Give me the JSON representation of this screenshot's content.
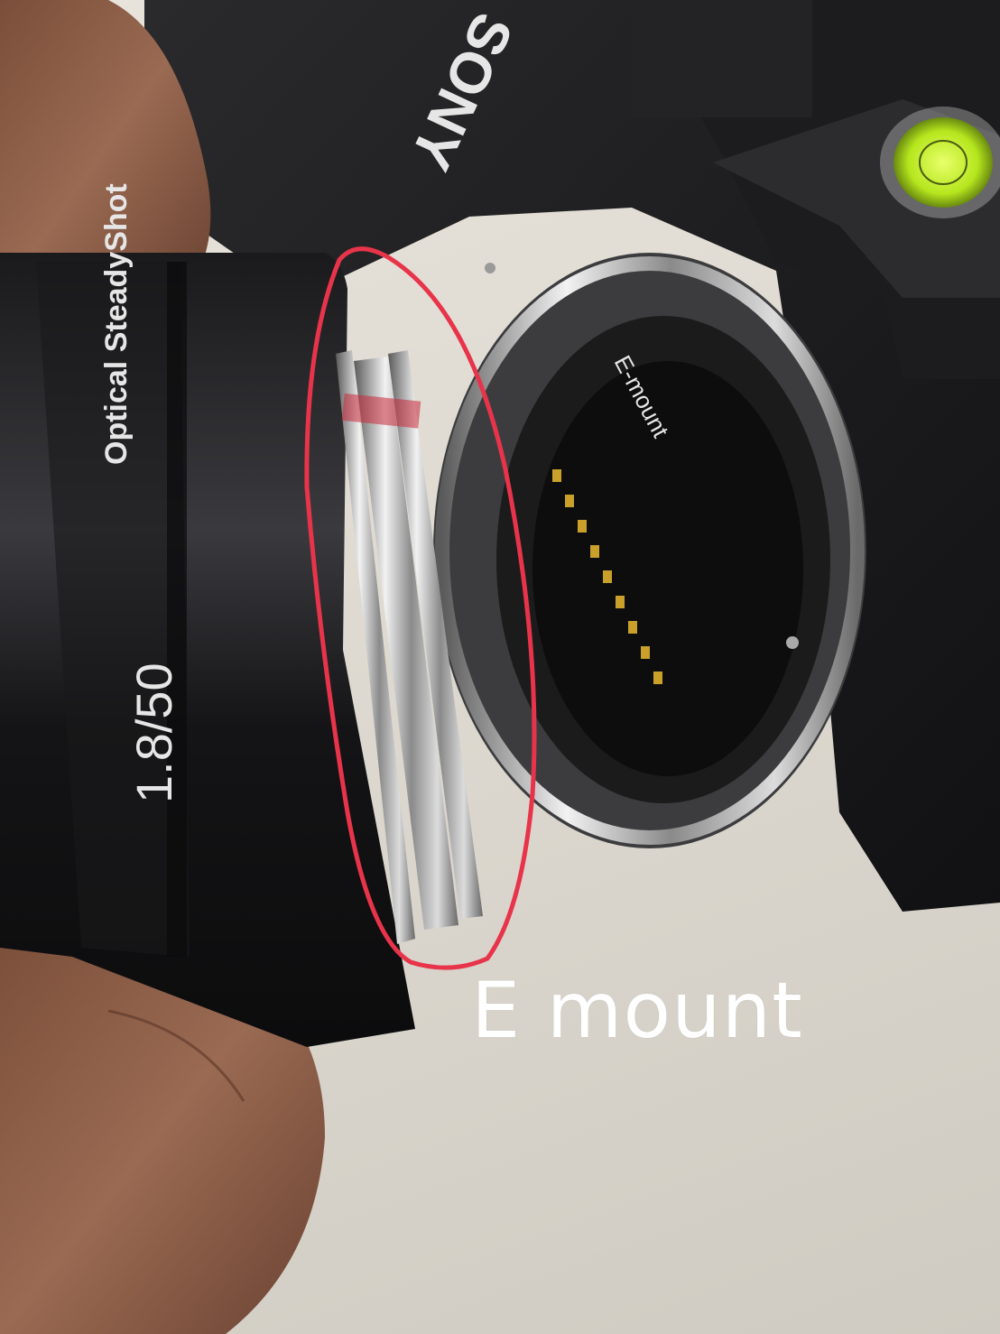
{
  "photo": {
    "caption": "E mount",
    "camera_brand_text": "SONY",
    "lens_label_model": "Optical SteadyShot",
    "lens_label_spec": "1.8/50",
    "mount_label": "E-mount",
    "highlight_color": "#e8344a",
    "bubble_level_color": "#b5e61d"
  }
}
